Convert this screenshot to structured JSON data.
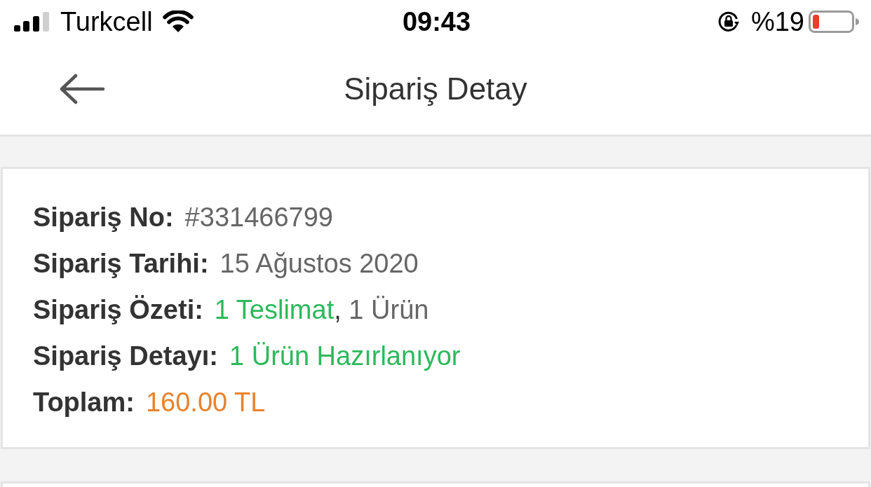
{
  "status_bar": {
    "carrier": "Turkcell",
    "time": "09:43",
    "battery": "%19"
  },
  "header": {
    "title": "Sipariş Detay"
  },
  "order_details": [
    {
      "label": "Sipariş No:",
      "value": [
        {
          "text": "#331466799",
          "color": "#666666"
        }
      ]
    },
    {
      "label": "Sipariş Tarihi:",
      "value": [
        {
          "text": "15 Ağustos 2020",
          "color": "#666666"
        }
      ]
    },
    {
      "label": "Sipariş Özeti:",
      "value": [
        {
          "text": "1 Teslimat",
          "color": "#2db95c"
        },
        {
          "text": ", ",
          "color": "#333333"
        },
        {
          "text": "1 Ürün",
          "color": "#666666"
        }
      ]
    },
    {
      "label": "Sipariş Detayı:",
      "value": [
        {
          "text": "1 Ürün Hazırlanıyor",
          "color": "#2db95c"
        }
      ]
    },
    {
      "label": "Toplam:",
      "value": [
        {
          "text": "160.00 TL",
          "color": "#e8832f"
        }
      ]
    }
  ]
}
